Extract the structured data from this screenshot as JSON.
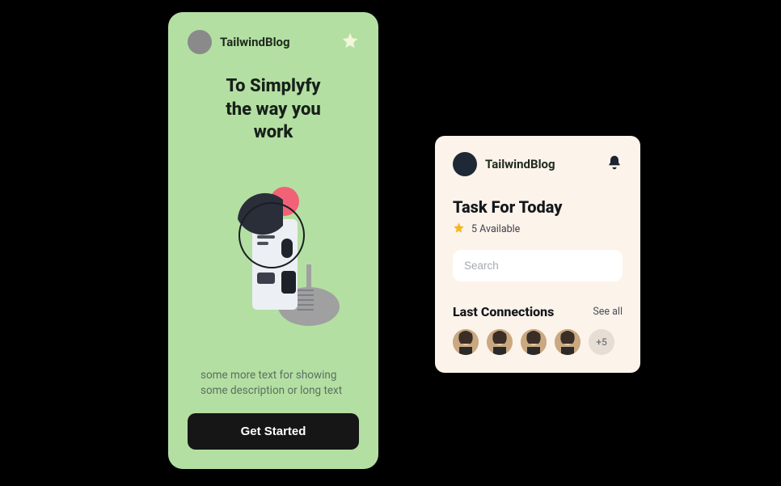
{
  "left_card": {
    "brand": "TailwindBlog",
    "headline": "To Simplyfy\nthe way you\nwork",
    "subtext": "some more text for showing some description or long text",
    "cta": "Get Started"
  },
  "right_card": {
    "brand": "TailwindBlog",
    "task_title": "Task For Today",
    "available_text": "5 Available",
    "search_placeholder": "Search",
    "connections_title": "Last Connections",
    "see_all": "See all",
    "more_count": "+5"
  }
}
